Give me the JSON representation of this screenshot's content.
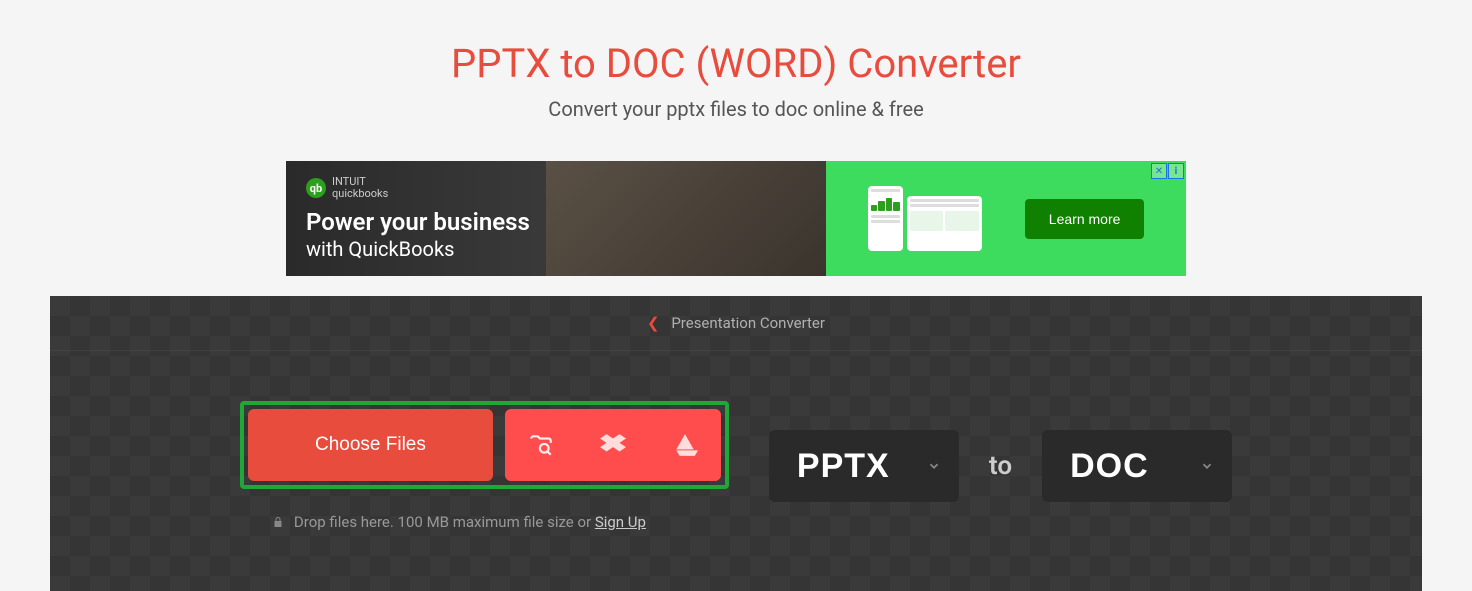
{
  "header": {
    "title": "PPTX to DOC (WORD) Converter",
    "subtitle": "Convert your pptx files to doc online & free"
  },
  "ad": {
    "logo_line1": "INTUIT",
    "logo_line2": "quickbooks",
    "headline": "Power your business",
    "subheadline": "with QuickBooks",
    "cta_label": "Learn more"
  },
  "breadcrumb": {
    "label": "Presentation Converter"
  },
  "controls": {
    "choose_files_label": "Choose Files",
    "from_format": "PPTX",
    "to_text": "to",
    "to_format": "DOC",
    "hint_prefix": "Drop files here. 100 MB maximum file size or ",
    "signup_label": "Sign Up"
  }
}
